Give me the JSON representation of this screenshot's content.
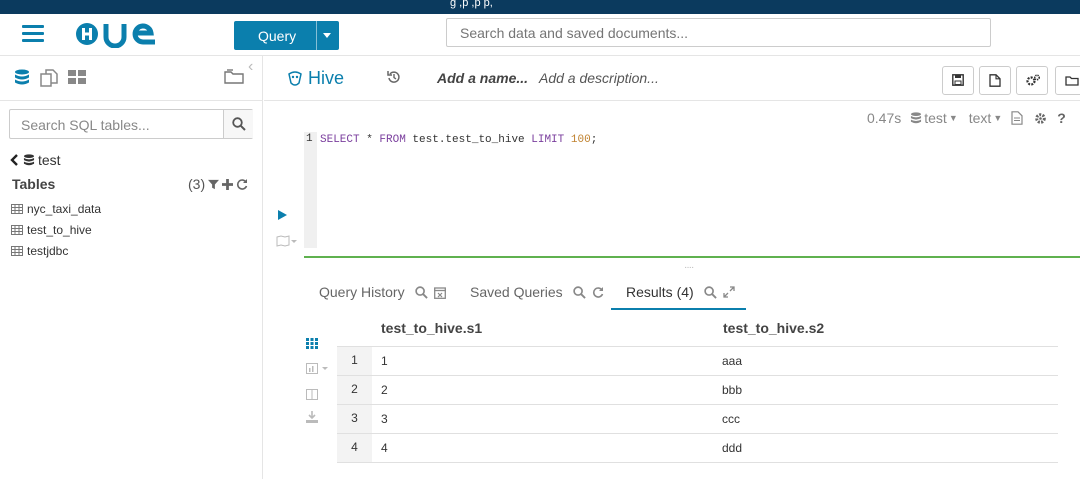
{
  "top_strip": {
    "text": "g  ,p    ,p                                  p,"
  },
  "header": {
    "logo": "HUE",
    "query_button": "Query",
    "search_placeholder": "Search data and saved documents..."
  },
  "left_panel": {
    "search_placeholder": "Search SQL tables...",
    "database": "test",
    "tables_label": "Tables",
    "tables_count": "(3)",
    "tables": [
      "nyc_taxi_data",
      "test_to_hive",
      "testjdbc"
    ]
  },
  "editor": {
    "engine": "Hive",
    "name_placeholder": "Add a name...",
    "description_placeholder": "Add a description...",
    "exec_time": "0.47s",
    "database_select": "test",
    "format_select": "text",
    "line_number": "1",
    "code": {
      "p1": "SELECT",
      "p2": " * ",
      "p3": "FROM",
      "p4": " test.test_to_hive ",
      "p5": "LIMIT",
      "p6": " ",
      "p7": "100",
      "p8": ";"
    }
  },
  "result_tabs": [
    {
      "label": "Query History"
    },
    {
      "label": "Saved Queries"
    },
    {
      "label": "Results (4)"
    }
  ],
  "results": {
    "columns": [
      "test_to_hive.s1",
      "test_to_hive.s2"
    ],
    "rows": [
      {
        "n": "1",
        "s1": "1",
        "s2": "aaa"
      },
      {
        "n": "2",
        "s1": "2",
        "s2": "bbb"
      },
      {
        "n": "3",
        "s1": "3",
        "s2": "ccc"
      },
      {
        "n": "4",
        "s1": "4",
        "s2": "ddd"
      }
    ]
  },
  "colors": {
    "accent": "#0B7FAD",
    "topbar": "#0B3A5E",
    "divider": "#5fb14f"
  }
}
